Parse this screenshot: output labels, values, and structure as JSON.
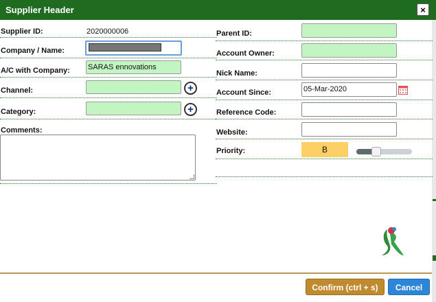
{
  "dialog": {
    "title": "Supplier Header",
    "close": "×"
  },
  "left": {
    "supplier_id_label": "Supplier ID:",
    "supplier_id_value": "2020000006",
    "company_label": "Company / Name:",
    "ac_label": "A/C with Company:",
    "ac_value": "SARAS ennovations",
    "channel_label": "Channel:",
    "channel_value": "",
    "category_label": "Category:",
    "category_value": "",
    "comments_label": "Comments:",
    "comments_value": "",
    "add_symbol": "+"
  },
  "right": {
    "parent_label": "Parent ID:",
    "parent_value": "",
    "owner_label": "Account Owner:",
    "owner_value": "",
    "nick_label": "Nick Name:",
    "nick_value": "",
    "since_label": "Account Since:",
    "since_value": "05-Mar-2020",
    "ref_label": "Reference Code:",
    "ref_value": "",
    "website_label": "Website:",
    "website_value": "",
    "priority_label": "Priority:",
    "priority_value": "B",
    "priority_level": 0.33
  },
  "colors": {
    "header_green": "#1f6b1f",
    "field_green": "#c2f5c2",
    "priority_yellow": "#fdd066",
    "confirm_brown": "#c08a2e",
    "cancel_blue": "#2e86d6"
  },
  "icons": {
    "close": "close-icon",
    "add": "plus-circle-icon",
    "calendar": "calendar-icon",
    "logo": "company-logo"
  },
  "footer": {
    "confirm_label": "Confirm (ctrl + s)",
    "cancel_label": "Cancel"
  }
}
